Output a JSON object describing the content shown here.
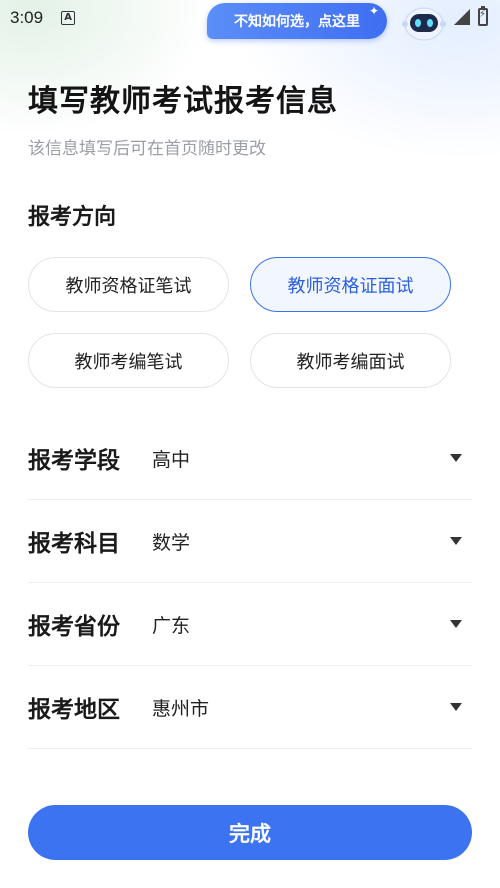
{
  "status_bar": {
    "time": "3:09",
    "notification_letter": "A"
  },
  "help": {
    "bubble_text": "不知如何选，点这里",
    "sparkle": "✦"
  },
  "header": {
    "title": "填写教师考试报考信息",
    "subtitle": "该信息填写后可在首页随时更改"
  },
  "direction": {
    "heading": "报考方向",
    "options": [
      {
        "label": "教师资格证笔试",
        "selected": false
      },
      {
        "label": "教师资格证面试",
        "selected": true
      },
      {
        "label": "教师考编笔试",
        "selected": false
      },
      {
        "label": "教师考编面试",
        "selected": false
      }
    ]
  },
  "fields": [
    {
      "label": "报考学段",
      "value": "高中"
    },
    {
      "label": "报考科目",
      "value": "数学"
    },
    {
      "label": "报考省份",
      "value": "广东"
    },
    {
      "label": "报考地区",
      "value": "惠州市"
    }
  ],
  "actions": {
    "done_label": "完成"
  },
  "colors": {
    "accent": "#3b73f0",
    "selected_bg": "#f2f6ff",
    "muted_text": "#9a9ea6"
  },
  "icons": [
    "notification-a-icon",
    "sparkle-icon",
    "robot-assistant-icon",
    "signal-icon",
    "battery-charging-icon",
    "dropdown-arrow-icon"
  ]
}
